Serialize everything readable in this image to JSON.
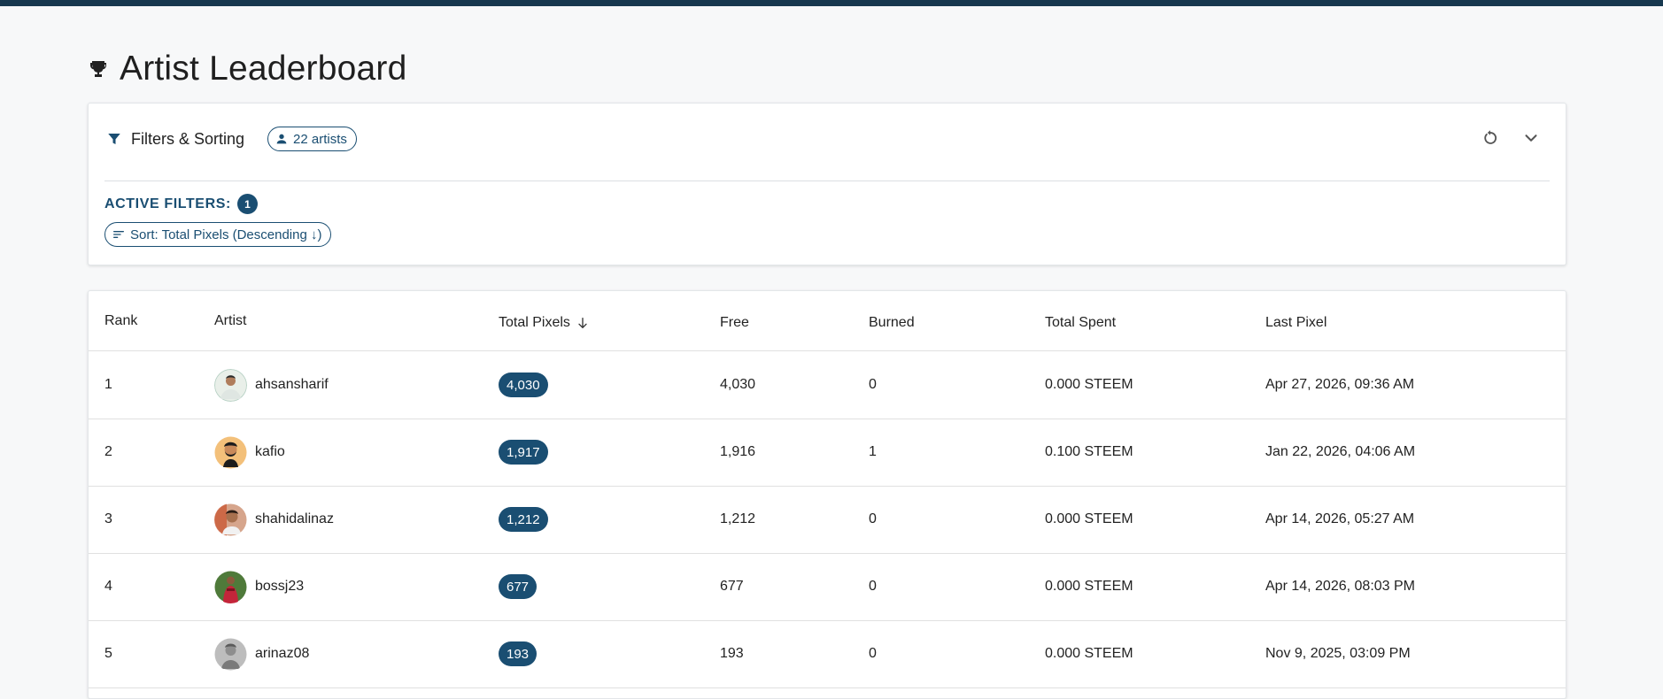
{
  "page": {
    "title": "Artist Leaderboard",
    "title_icon": "trophy-icon"
  },
  "filters": {
    "title": "Filters & Sorting",
    "artist_count_label": "22 artists",
    "active_filters_label": "ACTIVE FILTERS:",
    "active_filters_count": "1",
    "sort_chip_label": "Sort: Total Pixels (Descending ↓)",
    "reset_icon": "reset-icon",
    "collapse_icon": "chevron-down-icon"
  },
  "table": {
    "headers": {
      "rank": "Rank",
      "artist": "Artist",
      "total_pixels": "Total Pixels",
      "free": "Free",
      "burned": "Burned",
      "total_spent": "Total Spent",
      "last_pixel": "Last Pixel"
    },
    "sort_icon": "arrow-down-icon",
    "rows": [
      {
        "rank": "1",
        "artist": "ahsansharif",
        "total_pixels": "4,030",
        "free": "4,030",
        "burned": "0",
        "total_spent": "0.000 STEEM",
        "last_pixel": "Apr 27, 2026, 09:36 AM"
      },
      {
        "rank": "2",
        "artist": "kafio",
        "total_pixels": "1,917",
        "free": "1,916",
        "burned": "1",
        "total_spent": "0.100 STEEM",
        "last_pixel": "Jan 22, 2026, 04:06 AM"
      },
      {
        "rank": "3",
        "artist": "shahidalinaz",
        "total_pixels": "1,212",
        "free": "1,212",
        "burned": "0",
        "total_spent": "0.000 STEEM",
        "last_pixel": "Apr 14, 2026, 05:27 AM"
      },
      {
        "rank": "4",
        "artist": "bossj23",
        "total_pixels": "677",
        "free": "677",
        "burned": "0",
        "total_spent": "0.000 STEEM",
        "last_pixel": "Apr 14, 2026, 08:03 PM"
      },
      {
        "rank": "5",
        "artist": "arinaz08",
        "total_pixels": "193",
        "free": "193",
        "burned": "0",
        "total_spent": "0.000 STEEM",
        "last_pixel": "Nov 9, 2025, 03:09 PM"
      }
    ]
  },
  "colors": {
    "primary": "#1a4e72",
    "topbar": "#17384f",
    "background": "#f7f8f9"
  }
}
